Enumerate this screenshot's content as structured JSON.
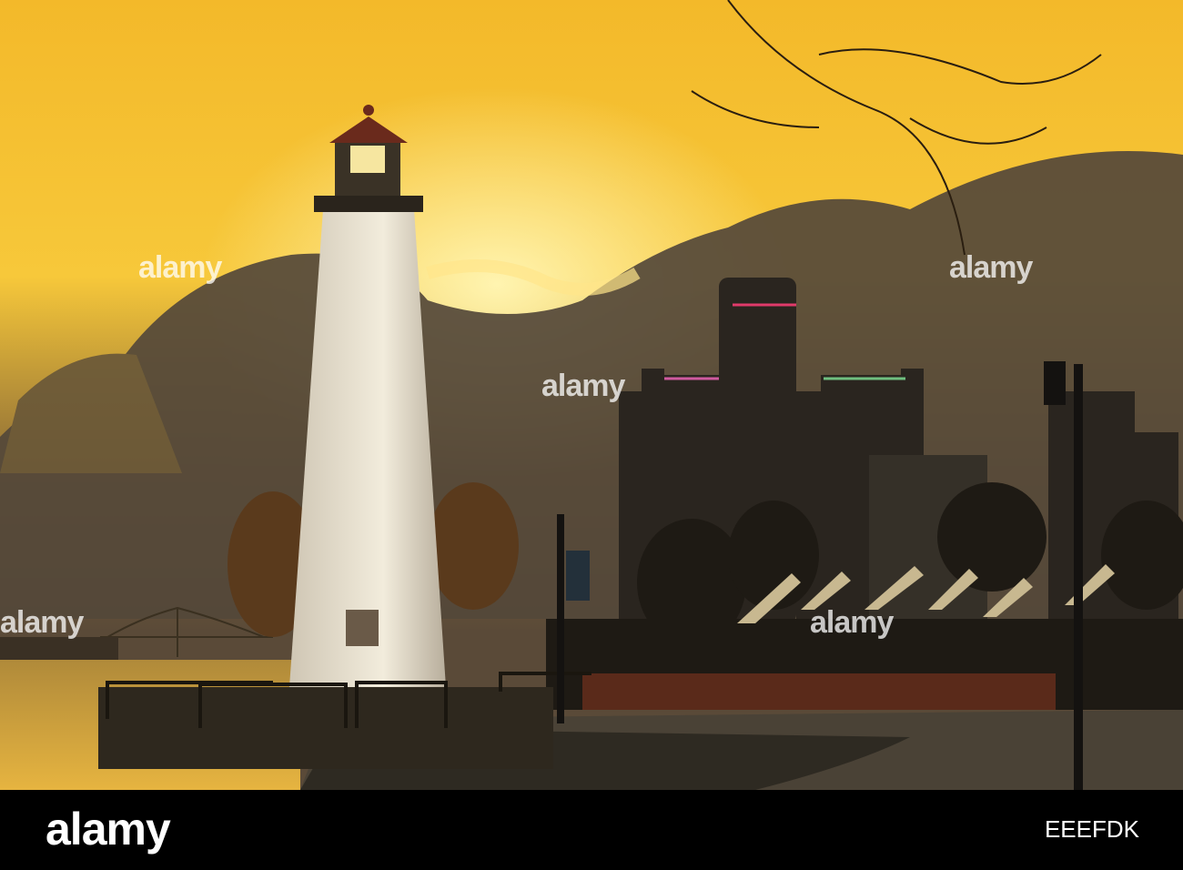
{
  "watermark": {
    "text": "alamy"
  },
  "footer": {
    "logo": "alamy",
    "image_id": "EEEFDK"
  },
  "colors": {
    "sky_top": "#f6c532",
    "sky_glow": "#fbe37a",
    "cloud": "#4a4034",
    "silhouette": "#1e1a14"
  }
}
